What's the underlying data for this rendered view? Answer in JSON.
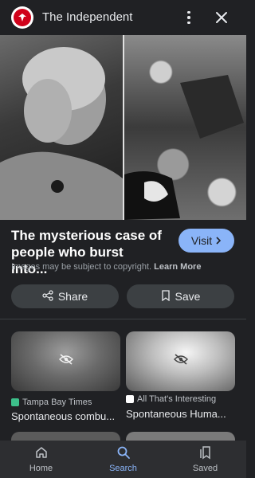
{
  "header": {
    "source_name": "The Independent",
    "logo_icon": "independent-eagle-logo",
    "menu_icon": "more-vert-icon",
    "close_icon": "close-icon"
  },
  "article": {
    "title_line1": "The mysterious case of",
    "title_line2": "people who burst into...",
    "visit_label": "Visit",
    "copyright_text": "Images may be subject to copyright.",
    "learn_more": "Learn More"
  },
  "actions": {
    "share_label": "Share",
    "save_label": "Save"
  },
  "related": [
    {
      "source": "Tampa Bay Times",
      "title": "Spontaneous combu...",
      "source_color": "#3dbf8a"
    },
    {
      "source": "All That's Interesting",
      "title": "Spontaneous Huma...",
      "source_color": "#ffffff"
    }
  ],
  "nav": {
    "home": "Home",
    "search": "Search",
    "saved": "Saved"
  },
  "colors": {
    "accent": "#8ab4f8",
    "background": "#202124",
    "logo_red": "#d0021b"
  }
}
